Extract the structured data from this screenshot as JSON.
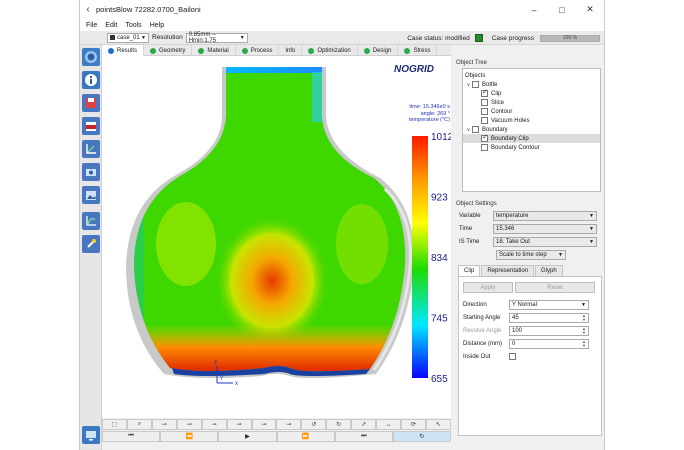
{
  "window": {
    "title": "pointsBlow 72282.0700_Bailoni"
  },
  "menu": [
    "File",
    "Edit",
    "Tools",
    "Help"
  ],
  "toolbar": {
    "case": "case_01",
    "resolution_label": "Resolution",
    "resolution": "0.85mm -- Hmin:1.75",
    "case_status_label": "Case status: modified",
    "case_progress_label": "Case progress",
    "case_progress_value": "100 %",
    "case_progress_fraction": 1.0
  },
  "tabs": [
    "Results",
    "Geometry",
    "Material",
    "Process",
    "Info",
    "Optimization",
    "Design",
    "Stress"
  ],
  "viewport": {
    "logo": "NOGRID",
    "info_lines": [
      "time: 15.346e0 s",
      "angle: 269 °",
      "temperature (°C)"
    ],
    "colorbar_ticks": [
      "1012",
      "923",
      "834",
      "745",
      "655"
    ],
    "colorbar_colors": [
      "#ff2200",
      "#ffaa00",
      "#ffff00",
      "#00dd00",
      "#00ffff",
      "#0000ff"
    ]
  },
  "object_tree": {
    "group_title": "Object Tree",
    "header": "Objects",
    "items": [
      {
        "label": "Bottle",
        "level": 0,
        "checked": false,
        "arrow": "v"
      },
      {
        "label": "Clip",
        "level": 1,
        "checked": true
      },
      {
        "label": "Slice",
        "level": 1,
        "checked": false
      },
      {
        "label": "Contour",
        "level": 1,
        "checked": false
      },
      {
        "label": "Vacuum Holes",
        "level": 1,
        "checked": false
      },
      {
        "label": "Boundary",
        "level": 0,
        "checked": false,
        "arrow": "v"
      },
      {
        "label": "Boundary Clip",
        "level": 1,
        "checked": true,
        "selected": true
      },
      {
        "label": "Boundary Contour",
        "level": 1,
        "checked": false
      }
    ]
  },
  "object_settings": {
    "group_title": "Object Settings",
    "variable_label": "Variable",
    "variable": "temperature",
    "time_label": "Time",
    "time": "15.346",
    "istime_label": "IS Time",
    "istime": "18. Take Out",
    "scale": "Scale to time step"
  },
  "subtabs": [
    "Clip",
    "Representation",
    "Glyph"
  ],
  "clip": {
    "apply": "Apply",
    "reset": "Reset",
    "direction_label": "Direction",
    "direction": "Y Normal",
    "starting_angle_label": "Starting Angle",
    "starting_angle": "45",
    "revolve_angle_label": "Revolve Angle",
    "revolve_angle": "100",
    "distance_label": "Distance (mm)",
    "distance": "0",
    "inside_out_label": "Inside Out"
  }
}
